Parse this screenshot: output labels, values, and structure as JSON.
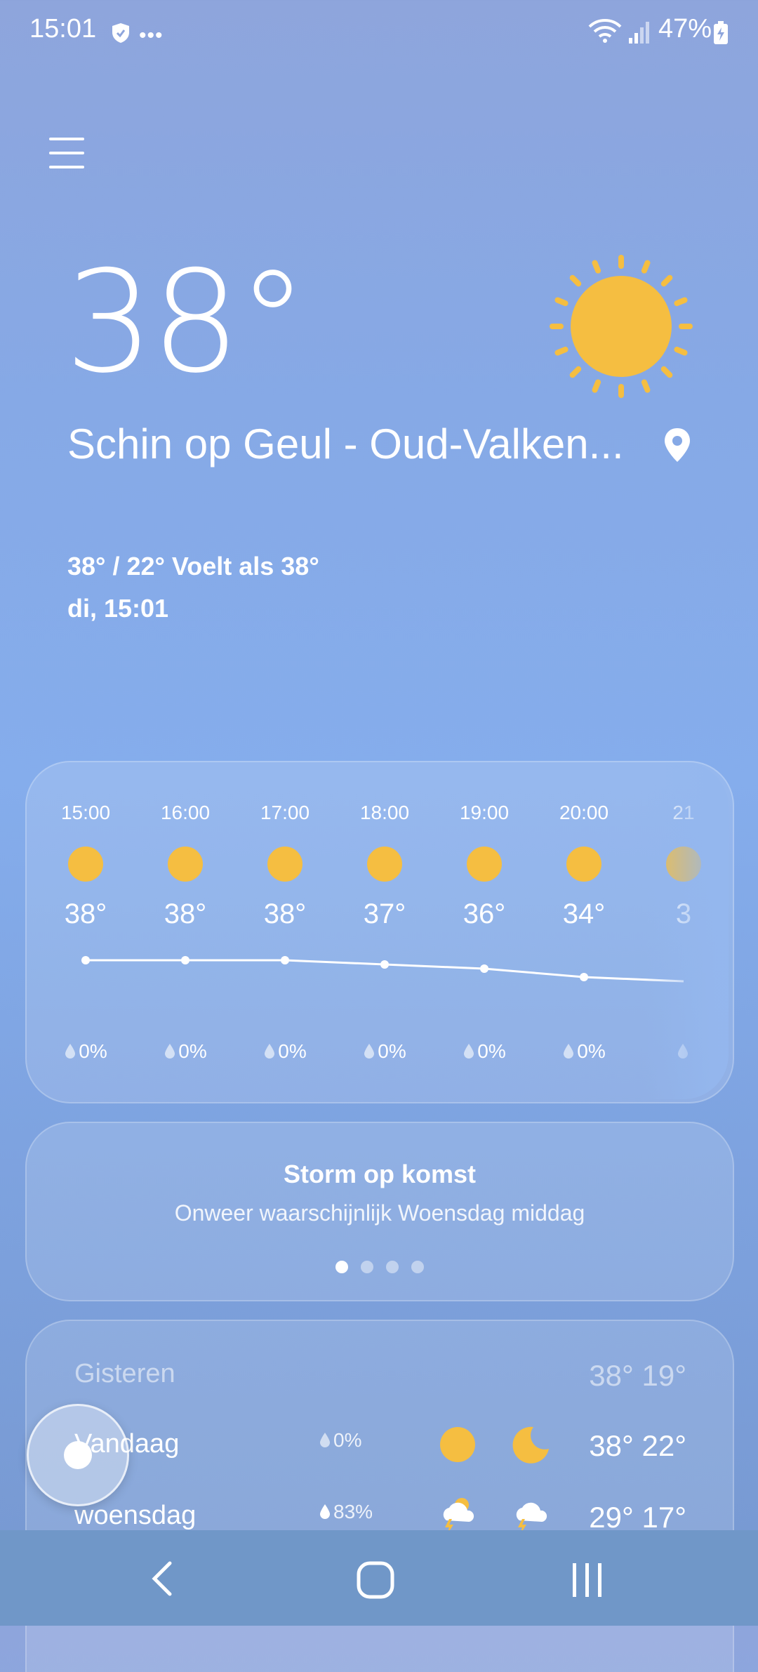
{
  "status_bar": {
    "time": "15:01",
    "dots": "•••",
    "battery": "47%"
  },
  "current": {
    "temperature": "38°",
    "location": "Schin op Geul - Oud-Valken...",
    "min_max_feels": "38° / 22° Voelt als 38°",
    "datetime": "di, 15:01",
    "icon": "sun-icon"
  },
  "hourly": [
    {
      "time": "15:00",
      "temp": "38°",
      "rain": "0%",
      "temp_value": 38
    },
    {
      "time": "16:00",
      "temp": "38°",
      "rain": "0%",
      "temp_value": 38
    },
    {
      "time": "17:00",
      "temp": "38°",
      "rain": "0%",
      "temp_value": 38
    },
    {
      "time": "18:00",
      "temp": "37°",
      "rain": "0%",
      "temp_value": 37
    },
    {
      "time": "19:00",
      "temp": "36°",
      "rain": "0%",
      "temp_value": 36
    },
    {
      "time": "20:00",
      "temp": "34°",
      "rain": "0%",
      "temp_value": 34
    },
    {
      "time": "21",
      "temp": "3",
      "rain": "",
      "temp_value": 33
    }
  ],
  "alert": {
    "title": "Storm op komst",
    "subtitle": "Onweer waarschijnlijk Woensdag middag",
    "pages": 4,
    "active_page": 1
  },
  "daily": [
    {
      "day": "Gisteren",
      "rain": "",
      "temps": "38° 19°"
    },
    {
      "day": "Vandaag",
      "rain": "0%",
      "temps": "38° 22°",
      "day_icon": "sun-icon",
      "night_icon": "moon-icon"
    },
    {
      "day": "woensdag",
      "rain": "83%",
      "temps": "29° 17°",
      "day_icon": "thunderstorm-icon",
      "night_icon": "thunderstorm-icon"
    }
  ],
  "colors": {
    "sun": "#f5be41",
    "background_top": "#8ea5dc",
    "background_mid": "#85adec"
  }
}
